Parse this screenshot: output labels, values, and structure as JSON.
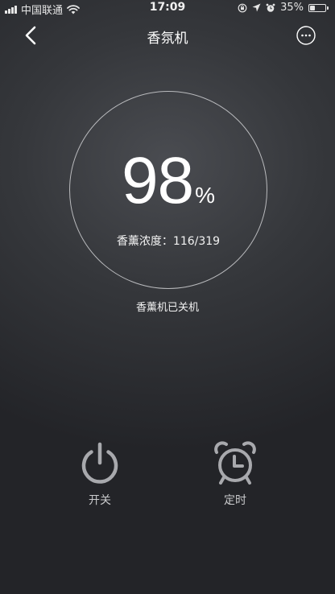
{
  "status_bar": {
    "carrier": "中国联通",
    "time": "17:09",
    "battery_percent": "35%",
    "battery_level": 0.35
  },
  "nav": {
    "title": "香氛机",
    "back_icon": "chevron-left-icon",
    "more_icon": "more-dots-icon"
  },
  "gauge": {
    "value": "98",
    "unit": "%",
    "concentration_label": "香薰浓度：",
    "concentration_value": "116/319"
  },
  "device_status": "香薰机已关机",
  "controls": {
    "power": {
      "label": "开关",
      "icon": "power-icon"
    },
    "timer": {
      "label": "定时",
      "icon": "alarm-clock-icon"
    }
  },
  "colors": {
    "background_center": "#4a4c51",
    "background_edge": "#232428",
    "gauge_ring": "#b9babd",
    "control_icon": "#a8a9ad",
    "text": "#ffffff"
  }
}
